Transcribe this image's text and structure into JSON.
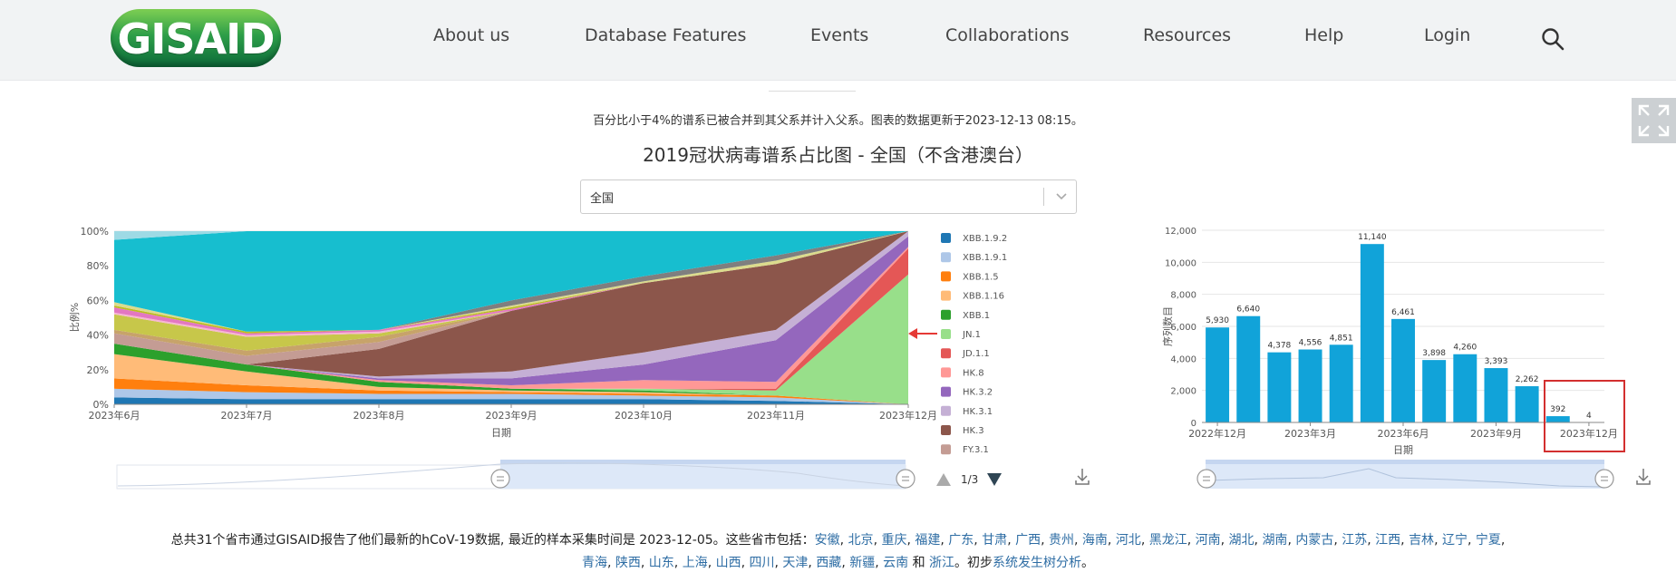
{
  "header": {
    "logo": "GISAID",
    "nav": [
      "About us",
      "Database Features",
      "Events",
      "Collaborations",
      "Resources",
      "Help",
      "Login"
    ]
  },
  "note": "百分比小于4%的谱系已被合并到其父系并计入父系。图表的数据更新于2023-12-13 08:15。",
  "title": "2019冠状病毒谱系占比图 - 全国（不含港澳台）",
  "select": {
    "value": "全国"
  },
  "legend": {
    "items": [
      "XBB.1.9.2",
      "XBB.1.9.1",
      "XBB.1.5",
      "XBB.1.16",
      "XBB.1",
      "JN.1",
      "JD.1.1",
      "HK.8",
      "HK.3.2",
      "HK.3.1",
      "HK.3",
      "FY.3.1"
    ],
    "colors": [
      "#1f77b4",
      "#aec7e8",
      "#ff7f0e",
      "#ffbb78",
      "#2ca02c",
      "#98df8a",
      "#e45756",
      "#ff9896",
      "#9467bd",
      "#c5b0d5",
      "#8c564b",
      "#c49c94"
    ],
    "page": "1/3"
  },
  "chart_data": [
    {
      "type": "area",
      "x": [
        "2023年6月",
        "2023年7月",
        "2023年8月",
        "2023年9月",
        "2023年10月",
        "2023年11月",
        "2023年12月"
      ],
      "xlabel": "日期",
      "ylabel": "比例%",
      "yticks": [
        "0%",
        "20%",
        "40%",
        "60%",
        "80%",
        "100%"
      ],
      "ylim": [
        0,
        100
      ],
      "series": [
        {
          "name": "XBB.1.9.2",
          "values": [
            4,
            3,
            3,
            3,
            3,
            2,
            0
          ]
        },
        {
          "name": "XBB.1.9.1",
          "values": [
            5,
            4,
            3,
            3,
            2,
            2,
            0
          ]
        },
        {
          "name": "XBB.1.5",
          "values": [
            6,
            4,
            2,
            1,
            1,
            1,
            0
          ]
        },
        {
          "name": "XBB.1.16",
          "values": [
            14,
            8,
            2,
            1,
            1,
            0,
            0
          ]
        },
        {
          "name": "XBB.1",
          "values": [
            6,
            4,
            3,
            1,
            1,
            0,
            0
          ]
        },
        {
          "name": "JN.1",
          "values": [
            0,
            0,
            0,
            0,
            1,
            3,
            75
          ]
        },
        {
          "name": "JD.1.1",
          "values": [
            0,
            0,
            0,
            0,
            0,
            1,
            15
          ]
        },
        {
          "name": "HK.8",
          "values": [
            0,
            0,
            1,
            2,
            5,
            4,
            1
          ]
        },
        {
          "name": "HK.3.2",
          "values": [
            0,
            0,
            1,
            4,
            9,
            24,
            6
          ]
        },
        {
          "name": "HK.3.1",
          "values": [
            0,
            0,
            1,
            4,
            7,
            6,
            3
          ]
        },
        {
          "name": "HK.3",
          "values": [
            0,
            0,
            16,
            35,
            40,
            38,
            0
          ]
        },
        {
          "name": "FY.3.1",
          "values": [
            6,
            5,
            4,
            0,
            0,
            0,
            0
          ]
        },
        {
          "values": [
            2,
            3,
            3,
            0,
            0,
            0,
            0
          ]
        },
        {
          "values": [
            9,
            8,
            2,
            0,
            0,
            0,
            0
          ]
        },
        {
          "values": [
            1,
            1,
            1,
            0,
            0,
            0,
            0
          ]
        },
        {
          "values": [
            3,
            1,
            1,
            1,
            0,
            0,
            0
          ]
        },
        {
          "values": [
            1,
            1,
            0,
            1,
            0,
            0,
            0
          ]
        },
        {
          "values": [
            2,
            0,
            0,
            1,
            1,
            2,
            0
          ]
        },
        {
          "values": [
            0,
            0,
            0,
            3,
            3,
            3,
            0
          ]
        },
        {
          "values": [
            36,
            58,
            57,
            40,
            26,
            14,
            0
          ]
        },
        {
          "values": [
            5,
            0,
            0,
            0,
            0,
            0,
            0
          ]
        }
      ]
    },
    {
      "type": "bar",
      "values": [
        5930,
        6640,
        4378,
        4556,
        4851,
        11140,
        6461,
        3898,
        4260,
        3393,
        2262,
        392,
        4
      ],
      "xticks": [
        "2022年12月",
        "2023年3月",
        "2023年6月",
        "2023年9月",
        "2023年12月"
      ],
      "yticks": [
        "0",
        "2,000",
        "4,000",
        "6,000",
        "8,000",
        "10,000",
        "12,000"
      ],
      "ylim": [
        0,
        12000
      ],
      "xlabel": "日期",
      "ylabel": "序列数目",
      "color": "#11a3d9"
    }
  ],
  "footer": {
    "prefix": "总共31个省市通过GISAID报告了他们最新的hCoV-19数据, 最近的样本采集时间是 2023-12-05。这些省市包括：",
    "provinces1": [
      "安徽",
      "北京",
      "重庆",
      "福建",
      "广东",
      "甘肃",
      "广西",
      "贵州",
      "海南",
      "河北",
      "黑龙江",
      "河南",
      "湖北",
      "湖南",
      "内蒙古",
      "江苏",
      "江西",
      "吉林",
      "辽宁",
      "宁夏"
    ],
    "provinces2": [
      "青海",
      "陕西",
      "山东",
      "上海",
      "山西",
      "四川",
      "天津",
      "西藏",
      "新疆",
      "云南"
    ],
    "and_word": "和",
    "last_province": "浙江",
    "tail_text": "。初步",
    "tail_link": "系统发生树分析",
    "end": "。"
  }
}
